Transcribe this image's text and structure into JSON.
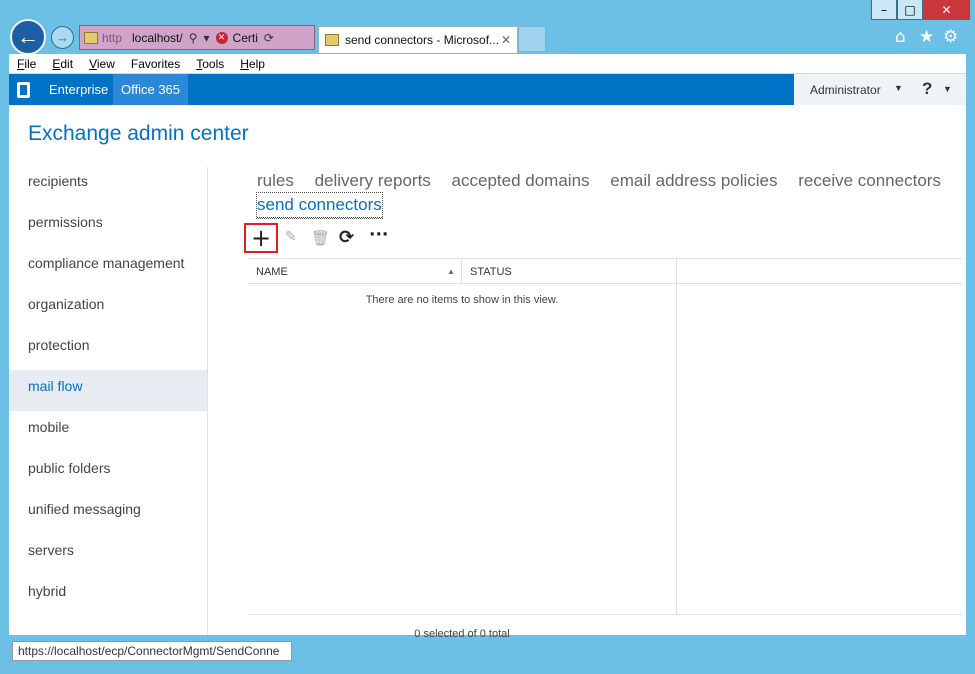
{
  "window": {
    "min_glyph": "–",
    "max_glyph": "□",
    "close_glyph": "✕"
  },
  "browser": {
    "address_prefix": "http",
    "address_host": "localhost/",
    "cert_label": "Certi",
    "active_tab_title": "send connectors - Microsof...",
    "tab_close_glyph": "✕",
    "toolbar_icons": [
      "home-icon",
      "favorites-star-icon",
      "settings-gear-icon"
    ]
  },
  "menu": {
    "items": [
      {
        "accel": "F",
        "rest": "ile"
      },
      {
        "accel": "E",
        "rest": "dit"
      },
      {
        "accel": "V",
        "rest": "iew"
      },
      {
        "accel": "",
        "rest": "Favorites"
      },
      {
        "accel": "T",
        "rest": "ools"
      },
      {
        "accel": "H",
        "rest": "elp"
      }
    ]
  },
  "header": {
    "enterprise": "Enterprise",
    "office365": "Office 365",
    "user": "Administrator",
    "help": "?"
  },
  "page": {
    "title": "Exchange admin center"
  },
  "nav": {
    "items": [
      "recipients",
      "permissions",
      "compliance management",
      "organization",
      "protection",
      "mail flow",
      "mobile",
      "public folders",
      "unified messaging",
      "servers",
      "hybrid"
    ],
    "active": "mail flow"
  },
  "subtabs": {
    "items": [
      "rules",
      "delivery reports",
      "accepted domains",
      "email address policies",
      "receive connectors",
      "send connectors"
    ],
    "active": "send connectors"
  },
  "toolbar": {
    "add": "+",
    "edit": "✎",
    "delete": "🗑",
    "refresh": "⟳",
    "more": "···"
  },
  "grid": {
    "columns": [
      "NAME",
      "STATUS"
    ],
    "sort_glyph": "▲",
    "empty_message": "There are no items to show in this view.",
    "footer": "0 selected of 0 total"
  },
  "status_bar": {
    "url": "https://localhost/ecp/ConnectorMgmt/SendConne"
  }
}
